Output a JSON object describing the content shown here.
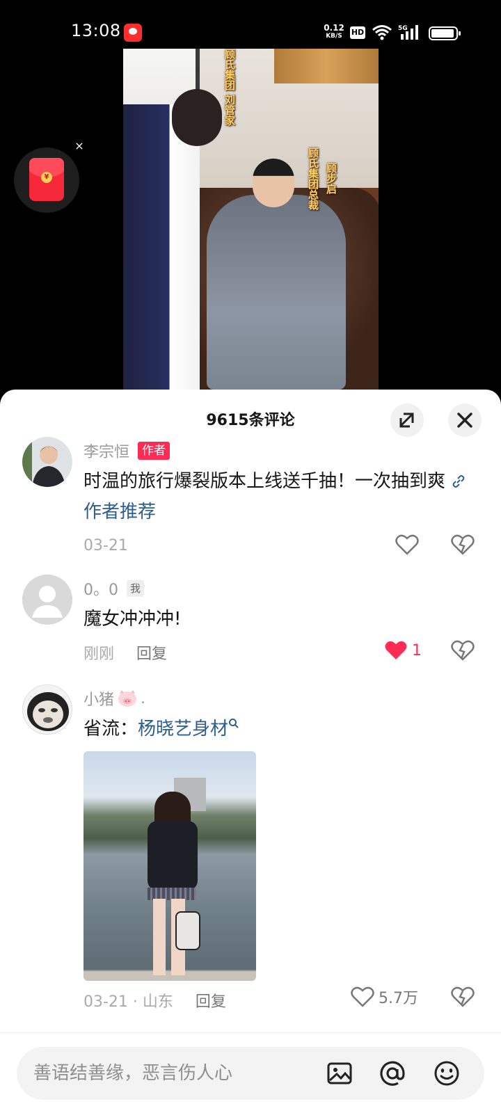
{
  "status_bar": {
    "time": "13:08",
    "net_speed": "0.12",
    "net_unit": "KB/S",
    "hd": "HD",
    "network": "5G"
  },
  "video": {
    "caption_butler": "顾氏集团 刘管家",
    "caption_ceo_title": "顾氏集团总裁",
    "caption_ceo_name": "顾步启"
  },
  "red_packet": {
    "coin": "¥",
    "close": "×"
  },
  "sheet": {
    "title": "9615条评论"
  },
  "comments": [
    {
      "name": "李宗恒",
      "badge": "作者",
      "text": "时温的旅行爆裂版本上线送千抽！一次抽到爽",
      "link": "作者推荐",
      "date": "03-21"
    },
    {
      "name": "0。0",
      "badge": "我",
      "text": "魔女冲冲冲!",
      "date": "刚刚",
      "reply": "回复",
      "likes": "1"
    },
    {
      "name": "小猪",
      "name_suffix": ".",
      "text_prefix": "省流：",
      "link": "杨晓艺身材",
      "date": "03-21 · 山东",
      "reply": "回复",
      "likes": "5.7万"
    }
  ],
  "input": {
    "placeholder": "善语结善缘，恶言伤人心"
  },
  "colors": {
    "accent": "#fe2c55",
    "link": "#2c5f8e"
  }
}
